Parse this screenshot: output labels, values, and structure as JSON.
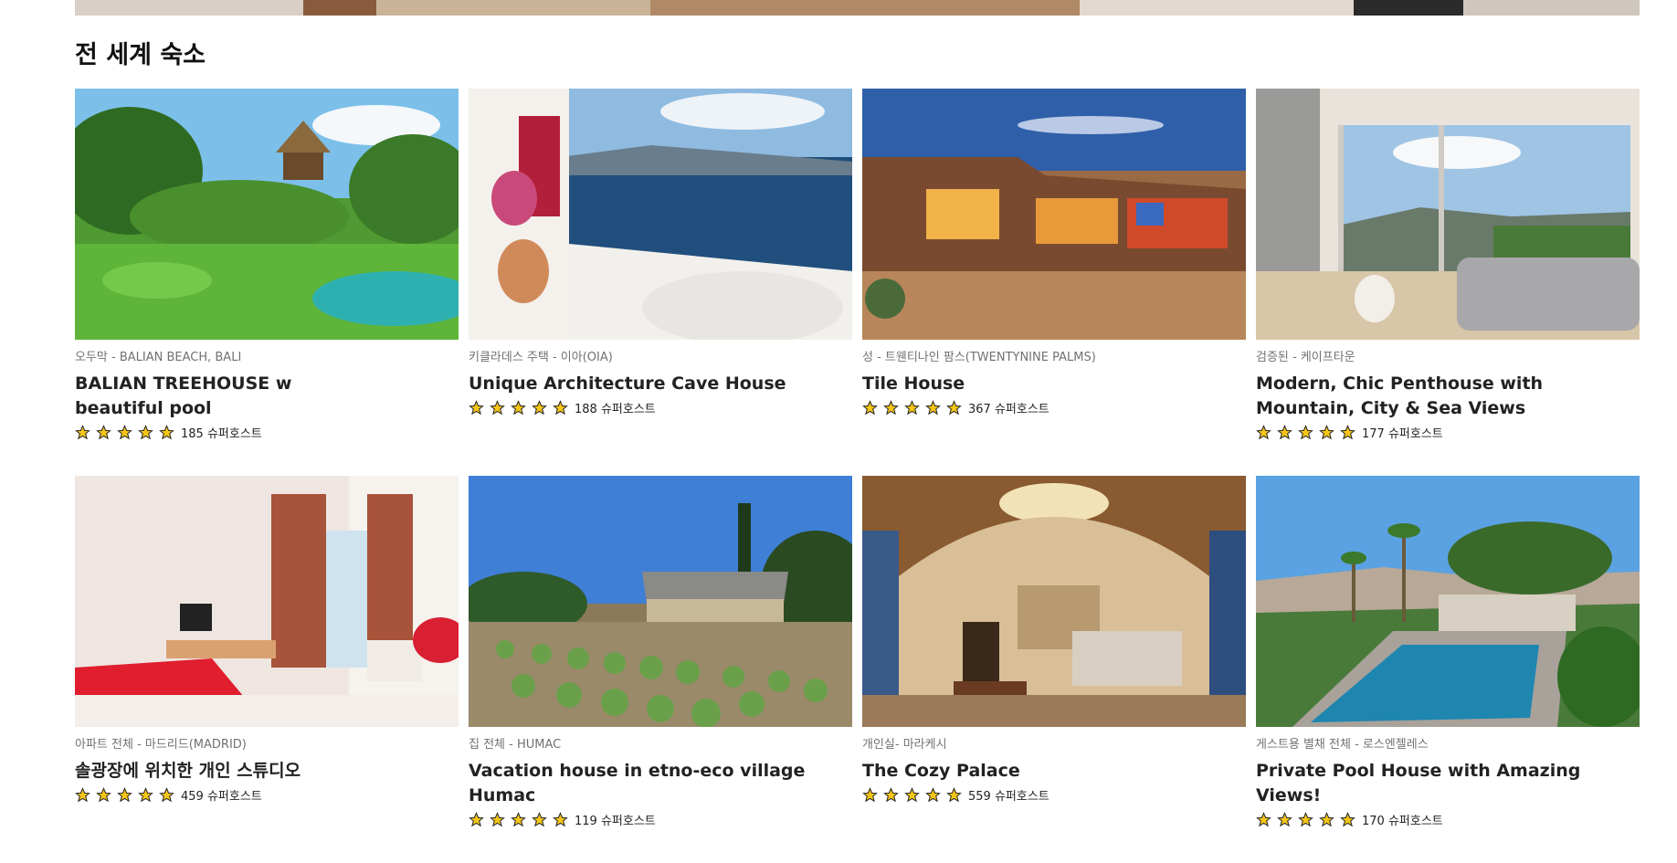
{
  "section": {
    "title": "전 세계 숙소"
  },
  "listings": [
    {
      "type_location": "오두막 - BALIAN BEACH, BALI",
      "title": "BALIAN TREEHOUSE w beautiful pool",
      "rating_text": "185 슈퍼호스트",
      "stars": 5
    },
    {
      "type_location": "키클라데스 주택 - 이아(OIA)",
      "title": "Unique Architecture Cave House",
      "rating_text": "188 슈퍼호스트",
      "stars": 5
    },
    {
      "type_location": "성 - 트웬티나인 팜스(TWENTYNINE PALMS)",
      "title": "Tile House",
      "rating_text": "367 슈퍼호스트",
      "stars": 5
    },
    {
      "type_location": "검증된 - 케이프타운",
      "title": "Modern, Chic Penthouse with Mountain, City & Sea Views",
      "rating_text": "177 슈퍼호스트",
      "stars": 5
    },
    {
      "type_location": "아파트 전체 - 마드리드(MADRID)",
      "title": "솔광장에 위치한 개인 스튜디오",
      "rating_text": "459 슈퍼호스트",
      "stars": 5
    },
    {
      "type_location": "집 전체 - HUMAC",
      "title": "Vacation house in etno-eco village Humac",
      "rating_text": "119 슈퍼호스트",
      "stars": 5
    },
    {
      "type_location": "개인실- 마라케시",
      "title": "The Cozy Palace",
      "rating_text": "559 슈퍼호스트",
      "stars": 5
    },
    {
      "type_location": "게스트용 별채 전체 - 로스엔젤레스",
      "title": "Private Pool House with Amazing Views!",
      "rating_text": "170 슈퍼호스트",
      "stars": 5
    }
  ],
  "colors": {
    "star": "#f5c518",
    "star_outline": "#222222",
    "subtitle": "#717171"
  },
  "icons": {
    "star": "star-icon"
  }
}
